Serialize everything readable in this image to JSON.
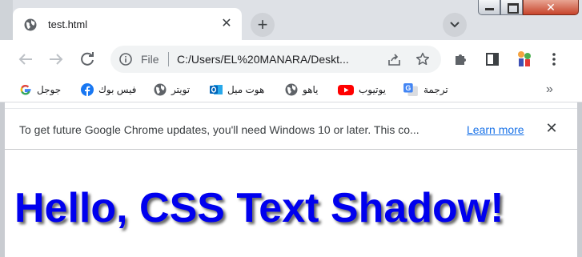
{
  "tab": {
    "title": "test.html",
    "icon": "globe-icon",
    "close_glyph": "✕",
    "new_tab_glyph": "+"
  },
  "window_controls": {
    "close_glyph": "✕"
  },
  "omnibox": {
    "scheme_label": "File",
    "url": "C:/Users/EL%20MANARA/Deskt..."
  },
  "bookmarks": [
    {
      "label": "جوجل",
      "icon": "google-icon"
    },
    {
      "label": "فيس بوك",
      "icon": "facebook-icon"
    },
    {
      "label": "تويتر",
      "icon": "globe-icon"
    },
    {
      "label": "هوت ميل",
      "icon": "outlook-icon"
    },
    {
      "label": "ياهو",
      "icon": "globe-icon"
    },
    {
      "label": "يوتيوب",
      "icon": "youtube-icon"
    },
    {
      "label": "ترجمة",
      "icon": "translate-icon"
    }
  ],
  "bookmarks_more": "»",
  "infobar": {
    "message": "To get future Google Chrome updates, you'll need Windows 10 or later. This co...",
    "link": "Learn more",
    "close_glyph": "✕"
  },
  "page": {
    "headline": "Hello, CSS Text Shadow!"
  },
  "colors": {
    "headline": "#0000ee",
    "link": "#1a73e8",
    "tabstrip": "#dee1e6"
  }
}
